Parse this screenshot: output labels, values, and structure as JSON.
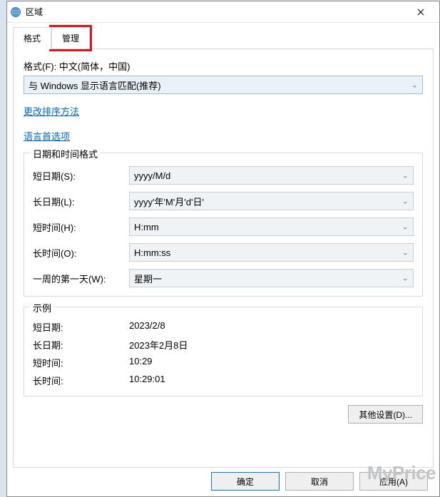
{
  "title": "区域",
  "tabs": {
    "format": "格式",
    "admin": "管理"
  },
  "format_label": "格式(F): 中文(简体，中国)",
  "format_value": "与 Windows 显示语言匹配(推荐)",
  "links": {
    "sort": "更改排序方法",
    "lang": "语言首选项"
  },
  "dt_group": {
    "title": "日期和时间格式",
    "short_date_label": "短日期(S):",
    "short_date_value": "yyyy/M/d",
    "long_date_label": "长日期(L):",
    "long_date_value": "yyyy'年'M'月'd'日'",
    "short_time_label": "短时间(H):",
    "short_time_value": "H:mm",
    "long_time_label": "长时间(O):",
    "long_time_value": "H:mm:ss",
    "first_day_label": "一周的第一天(W):",
    "first_day_value": "星期一"
  },
  "example_group": {
    "title": "示例",
    "short_date_label": "短日期:",
    "short_date_value": "2023/2/8",
    "long_date_label": "长日期:",
    "long_date_value": "2023年2月8日",
    "short_time_label": "短时间:",
    "short_time_value": "10:29",
    "long_time_label": "长时间:",
    "long_time_value": "10:29:01"
  },
  "buttons": {
    "additional": "其他设置(D)...",
    "ok": "确定",
    "cancel": "取消",
    "apply": "应用(A)"
  },
  "watermark": "MyPrice"
}
